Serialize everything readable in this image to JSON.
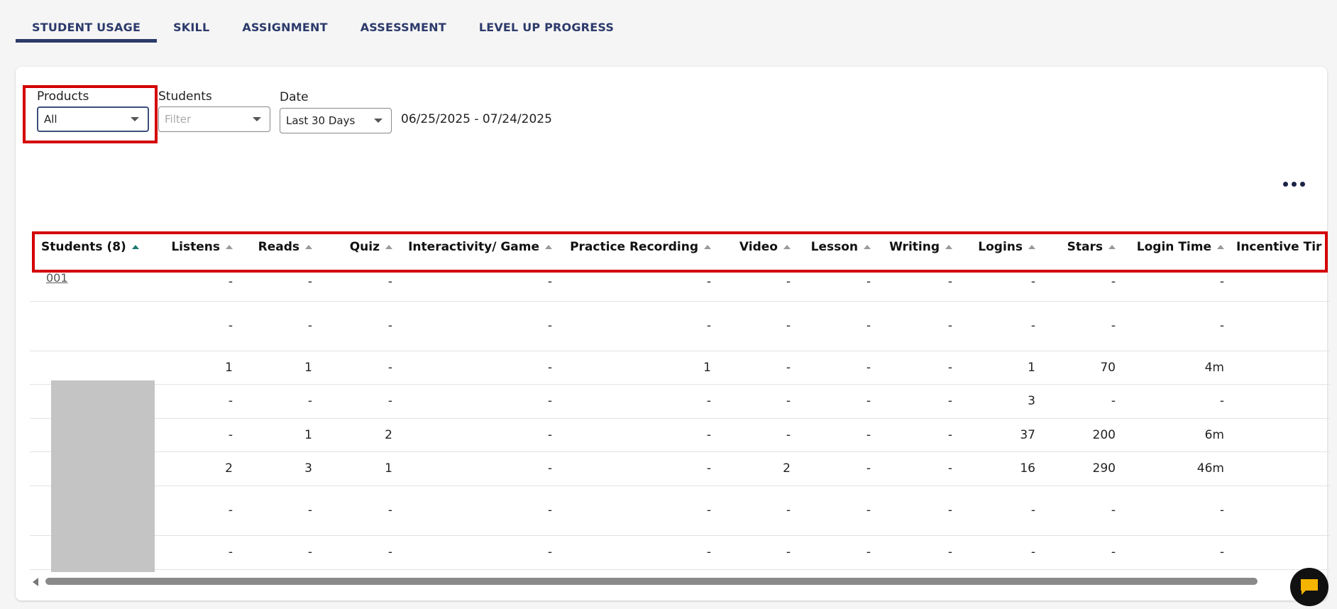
{
  "tabs": [
    {
      "label": "STUDENT USAGE",
      "active": true
    },
    {
      "label": "SKILL"
    },
    {
      "label": "ASSIGNMENT"
    },
    {
      "label": "ASSESSMENT"
    },
    {
      "label": "LEVEL UP PROGRESS"
    }
  ],
  "filters": {
    "products": {
      "label": "Products",
      "value": "All"
    },
    "students": {
      "label": "Students",
      "placeholder": "Filter"
    },
    "date": {
      "label": "Date",
      "value": "Last 30 Days"
    },
    "date_range": "06/25/2025 - 07/24/2025"
  },
  "table": {
    "columns": [
      "Students (8)",
      "Listens",
      "Reads",
      "Quiz",
      "Interactivity/ Game",
      "Practice Recording",
      "Video",
      "Lesson",
      "Writing",
      "Logins",
      "Stars",
      "Login Time",
      "Incentive Tir"
    ],
    "first_student": "001",
    "rows": [
      [
        "-",
        "-",
        "-",
        "-",
        "-",
        "-",
        "-",
        "-",
        "-",
        "-",
        "-"
      ],
      [
        "-",
        "-",
        "-",
        "-",
        "-",
        "-",
        "-",
        "-",
        "-",
        "-",
        "-"
      ],
      [
        "1",
        "1",
        "-",
        "-",
        "1",
        "-",
        "-",
        "-",
        "1",
        "70",
        "4m"
      ],
      [
        "-",
        "-",
        "-",
        "-",
        "-",
        "-",
        "-",
        "-",
        "3",
        "-",
        "-"
      ],
      [
        "-",
        "1",
        "2",
        "-",
        "-",
        "-",
        "-",
        "-",
        "37",
        "200",
        "6m"
      ],
      [
        "2",
        "3",
        "1",
        "-",
        "-",
        "2",
        "-",
        "-",
        "16",
        "290",
        "46m"
      ],
      [
        "-",
        "-",
        "-",
        "-",
        "-",
        "-",
        "-",
        "-",
        "-",
        "-",
        "-"
      ],
      [
        "-",
        "-",
        "-",
        "-",
        "-",
        "-",
        "-",
        "-",
        "-",
        "-",
        "-"
      ]
    ]
  },
  "colors": {
    "accent": "#2c3a6b",
    "highlight": "#d40000",
    "sort_active": "#1d7a6e"
  }
}
